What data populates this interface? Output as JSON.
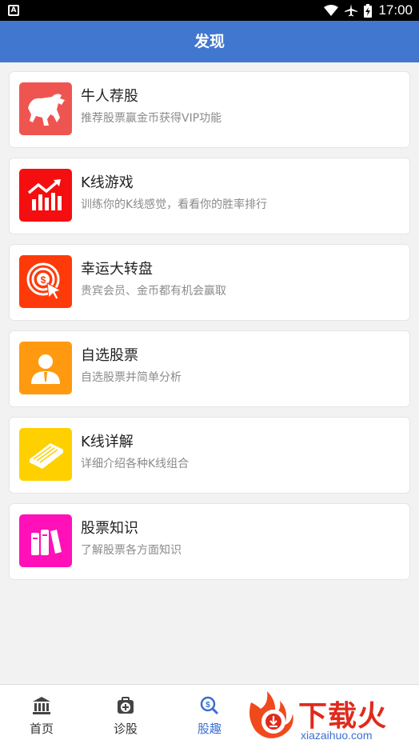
{
  "status_bar": {
    "notification_icon_glyph": "A",
    "time": "17:00"
  },
  "header": {
    "title": "发现"
  },
  "cards": [
    {
      "title": "牛人荐股",
      "subtitle": "推荐股票赢金币获得VIP功能",
      "icon": "bull-icon",
      "color": "#ef5550"
    },
    {
      "title": "K线游戏",
      "subtitle": "训练你的K线感觉，看看你的胜率排行",
      "icon": "rising-chart-icon",
      "color": "#f50e10"
    },
    {
      "title": "幸运大转盘",
      "subtitle": "贵宾会员、金币都有机会赢取",
      "icon": "lucky-wheel-icon",
      "color": "#ff3a0a"
    },
    {
      "title": "自选股票",
      "subtitle": "自选股票并简单分析",
      "icon": "user-icon",
      "color": "#ff9a10"
    },
    {
      "title": "K线详解",
      "subtitle": "详细介绍各种K线组合",
      "icon": "book-icon",
      "color": "#ffd000"
    },
    {
      "title": "股票知识",
      "subtitle": "了解股票各方面知识",
      "icon": "books-icon",
      "color": "#ff10b8"
    }
  ],
  "tabs": [
    {
      "label": "首页",
      "icon": "bank-icon",
      "active": false
    },
    {
      "label": "诊股",
      "icon": "medical-kit-icon",
      "active": false
    },
    {
      "label": "股趣",
      "icon": "coin-search-icon",
      "active": true
    }
  ],
  "watermark": {
    "brand": "下载火",
    "url": "xiazaihuo.com"
  },
  "colors": {
    "header_bg": "#4177cf",
    "active_tab": "#3a6fd1",
    "watermark_red": "#e02a1c"
  }
}
